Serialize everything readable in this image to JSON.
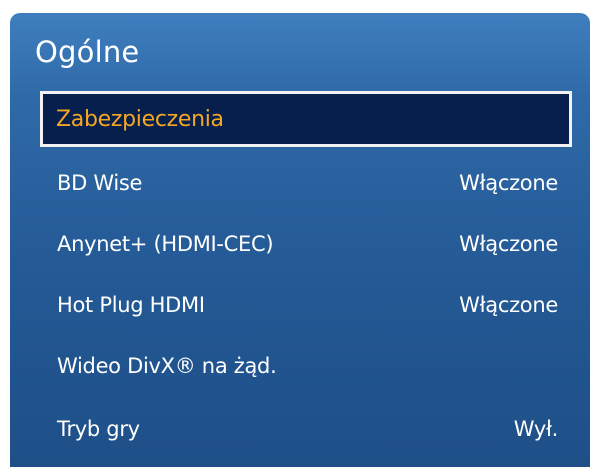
{
  "menu": {
    "title": "Ogólne",
    "items": [
      {
        "label": "Zabezpieczenia",
        "value": ""
      },
      {
        "label": "BD Wise",
        "value": "Włączone"
      },
      {
        "label": "Anynet+ (HDMI-CEC)",
        "value": "Włączone"
      },
      {
        "label": "Hot Plug HDMI",
        "value": "Włączone"
      },
      {
        "label": "Wideo DivX® na żąd.",
        "value": ""
      },
      {
        "label": "Tryb gry",
        "value": "Wył."
      }
    ],
    "colors": {
      "panel_top": "#3f7fbf",
      "panel_bottom": "#1e4f88",
      "selected_background": "#061f4c",
      "selected_text": "#f5a623",
      "selected_border": "#f2f2f2",
      "text": "#ffffff"
    }
  }
}
